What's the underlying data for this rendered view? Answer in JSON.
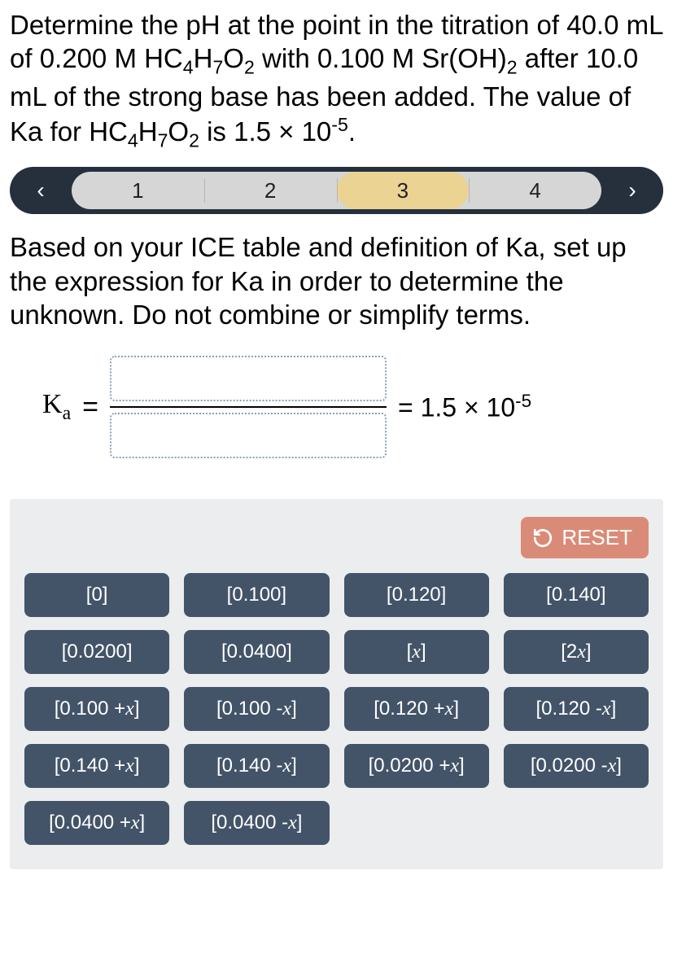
{
  "question_html": "Determine the pH at the point in the titration of 40.0 mL of 0.200 M HC<sub>4</sub>H<sub>7</sub>O<sub>2</sub> with 0.100 M Sr(OH)<sub>2</sub> after 10.0 mL of the strong base has been added. The value of Ka for HC<sub>4</sub>H<sub>7</sub>O<sub>2</sub> is 1.5 × 10<sup>-5</sup>.",
  "stepper": {
    "prev_label": "‹",
    "next_label": "›",
    "steps": [
      "1",
      "2",
      "3",
      "4"
    ],
    "active_index": 2
  },
  "instruction": "Based on your ICE table and definition of Ka, set up the expression for Ka in order to determine the unknown. Do not combine or simplify terms.",
  "equation": {
    "lhs_html": "K<span class=\"subi\">a</span>",
    "equals": "=",
    "rhs_html": "= 1.5 × 10<sup>-5</sup>"
  },
  "reset_label": "RESET",
  "tiles": [
    {
      "html": "[0]"
    },
    {
      "html": "[0.100]"
    },
    {
      "html": "[0.120]"
    },
    {
      "html": "[0.140]"
    },
    {
      "html": "[0.0200]"
    },
    {
      "html": "[0.0400]"
    },
    {
      "html": "[<span class=\"x\">x</span>]"
    },
    {
      "html": "[2<span class=\"x\">x</span>]"
    },
    {
      "html": "[0.100 + <span class=\"x\">x</span>]"
    },
    {
      "html": "[0.100 - <span class=\"x\">x</span>]"
    },
    {
      "html": "[0.120 + <span class=\"x\">x</span>]"
    },
    {
      "html": "[0.120 - <span class=\"x\">x</span>]"
    },
    {
      "html": "[0.140 + <span class=\"x\">x</span>]"
    },
    {
      "html": "[0.140 - <span class=\"x\">x</span>]"
    },
    {
      "html": "[0.0200 + <span class=\"x\">x</span>]"
    },
    {
      "html": "[0.0200 - <span class=\"x\">x</span>]"
    },
    {
      "html": "[0.0400 + <span class=\"x\">x</span>]"
    },
    {
      "html": "[0.0400 - <span class=\"x\">x</span>]"
    }
  ]
}
